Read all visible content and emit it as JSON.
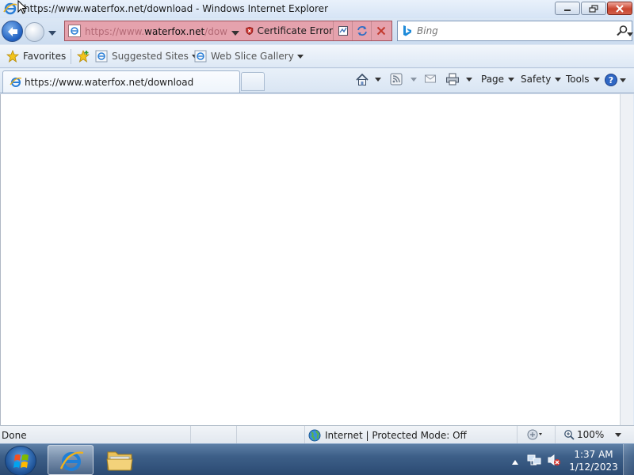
{
  "window": {
    "title": "https://www.waterfox.net/download - Windows Internet Explorer"
  },
  "nav": {
    "url_prefix": "https://www.",
    "url_domain": "waterfox.net",
    "url_suffix": "/downlo",
    "certificate_error": "Certificate Error",
    "search_placeholder": "Bing"
  },
  "favorites_bar": {
    "favorites_label": "Favorites",
    "suggested_sites": "Suggested Sites",
    "web_slice_gallery": "Web Slice Gallery"
  },
  "tabs": [
    {
      "label": "https://www.waterfox.net/download"
    }
  ],
  "commands": {
    "page": "Page",
    "safety": "Safety",
    "tools": "Tools"
  },
  "status": {
    "text": "Done",
    "zone": "Internet | Protected Mode: Off",
    "zoom": "100%"
  },
  "taskbar": {
    "time": "1:37 AM",
    "date": "1/12/2023"
  },
  "colors": {
    "address_error_bg": "#e5a2ad",
    "chrome_bg": "#dbe7f5",
    "taskbar_bg": "#3d5f88"
  }
}
